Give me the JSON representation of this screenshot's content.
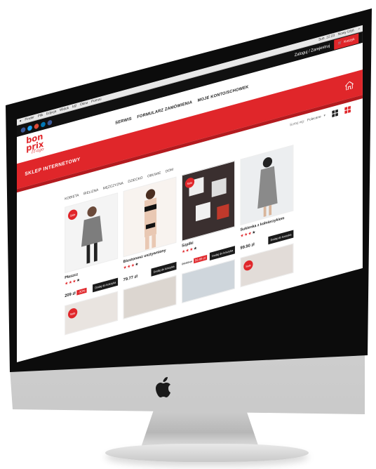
{
  "mac_menu": {
    "left": [
      "Finder",
      "Plik",
      "Edycja",
      "Widok",
      "Idź",
      "Okno",
      "Pomoc"
    ],
    "right": [
      "Sob. 22:23",
      "Nowy Użyt."
    ]
  },
  "top": {
    "login_text": "Zaloguj / Zarejestruj",
    "cart_label": "Koszyk",
    "social_colors": [
      "#3b5998",
      "#1da1f2",
      "#dd4b39",
      "#0077b5",
      "#3b5998"
    ]
  },
  "logo": {
    "line1": "bon",
    "line2": "prix",
    "tagline": "IT-ago"
  },
  "nav": {
    "items": [
      "SERWIS",
      "FORMULARZ ZAMÓWIENIA",
      "MOJE KONTO/SCHOWEK"
    ]
  },
  "banner": {
    "title": "SKLEP INTERNETOWY"
  },
  "sort": {
    "label": "Sortuj wg:",
    "value": "Polecane"
  },
  "categories": [
    "Kobieta",
    "Bielizna",
    "Mężczyzna",
    "Dziecko",
    "Obuwie",
    "Dom"
  ],
  "products": [
    {
      "name": "Płaszcz",
      "stars": 4,
      "price": "209 zł",
      "old_price": "",
      "sale": "-30%",
      "badge": "Sale",
      "add": "Dodaj do koszyka"
    },
    {
      "name": "Biustonosz usztywniony",
      "stars": 4,
      "price": "79.77 zł",
      "old_price": "",
      "sale": "",
      "badge": "",
      "add": "Dodaj do koszyka"
    },
    {
      "name": "Szpilki",
      "stars": 4,
      "price": "",
      "old_price": "99.99 zł",
      "sale": "59.99 zł",
      "badge": "Sale",
      "add": "Dodaj do koszyka"
    },
    {
      "name": "Sukienka z kołnierzykiem",
      "stars": 4,
      "price": "99.90 zł",
      "old_price": "",
      "sale": "",
      "badge": "",
      "add": "Dodaj do koszyka"
    }
  ],
  "row2_badges": [
    "Sale",
    "",
    "",
    "Sale"
  ],
  "colors": {
    "accent": "#e0262a",
    "dark": "#111111"
  }
}
